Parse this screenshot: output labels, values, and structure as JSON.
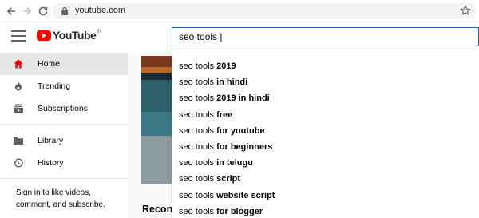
{
  "browser": {
    "url": "youtube.com"
  },
  "header": {
    "logo_text": "YouTube",
    "logo_country": "IN",
    "search_value": "seo tools |"
  },
  "sidebar": {
    "items": [
      {
        "label": "Home",
        "icon": "home-icon",
        "active": true
      },
      {
        "label": "Trending",
        "icon": "flame-icon",
        "active": false
      },
      {
        "label": "Subscriptions",
        "icon": "subscriptions-icon",
        "active": false
      },
      {
        "label": "Library",
        "icon": "folder-icon",
        "active": false
      },
      {
        "label": "History",
        "icon": "history-icon",
        "active": false
      }
    ],
    "signin_text": "Sign in to like videos, comment, and subscribe."
  },
  "main": {
    "section_title": "Recon"
  },
  "suggestions": [
    {
      "prefix": "seo tools ",
      "rest": "2019"
    },
    {
      "prefix": "seo tools ",
      "rest": "in hindi"
    },
    {
      "prefix": "seo tools ",
      "rest": "2019 in hindi"
    },
    {
      "prefix": "seo tools ",
      "rest": "free"
    },
    {
      "prefix": "seo tools ",
      "rest": "for youtube"
    },
    {
      "prefix": "seo tools ",
      "rest": "for beginners"
    },
    {
      "prefix": "seo tools ",
      "rest": "in telugu"
    },
    {
      "prefix": "seo tools ",
      "rest": "script"
    },
    {
      "prefix": "seo tools ",
      "rest": "website script"
    },
    {
      "prefix": "seo tools ",
      "rest": "for blogger"
    }
  ],
  "colors": {
    "accent_red": "#ff0000",
    "search_border": "#1c62b9",
    "active_bg": "#e5e5e5"
  }
}
